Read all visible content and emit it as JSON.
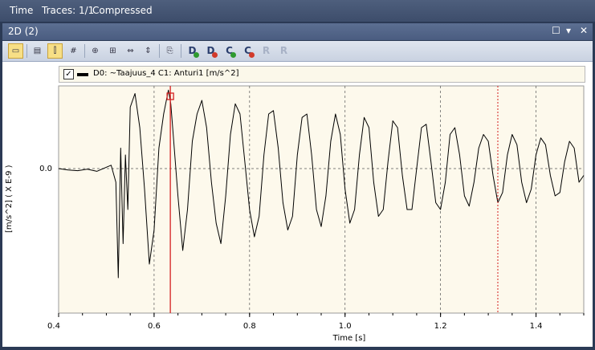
{
  "menu": {
    "time": "Time",
    "traces": "Traces: 1/1",
    "mode": "Compressed"
  },
  "panel": {
    "title": "2D (2)",
    "restore_icon": "restore-icon",
    "menu_icon": "chevron-down-icon",
    "close_icon": "close-icon"
  },
  "toolbar": {
    "buttons": [
      {
        "name": "legend-toggle-button",
        "active": true
      },
      {
        "name": "layout-button",
        "active": false
      },
      {
        "name": "single-cursor-button",
        "active": true
      },
      {
        "name": "grid-button",
        "active": false
      },
      {
        "name": "zoom-fit-button",
        "active": false
      },
      {
        "name": "zoom-in-button",
        "active": false
      },
      {
        "name": "zoom-x-button",
        "active": false
      },
      {
        "name": "zoom-y-button",
        "active": false
      },
      {
        "name": "copy-button",
        "active": false
      }
    ],
    "letters": [
      {
        "label": "D",
        "badge": "add",
        "color": "#2f9a2f",
        "enabled": true
      },
      {
        "label": "D",
        "badge": "remove",
        "color": "#d23a2a",
        "enabled": true
      },
      {
        "label": "C",
        "badge": "add",
        "color": "#2f9a2f",
        "enabled": true
      },
      {
        "label": "C",
        "badge": "remove",
        "color": "#d23a2a",
        "enabled": true
      },
      {
        "label": "R",
        "badge": "undo",
        "color": "#a8b2c6",
        "enabled": false
      },
      {
        "label": "R",
        "badge": "remove",
        "color": "#a8b2c6",
        "enabled": false
      }
    ]
  },
  "legend": {
    "checked": true,
    "label": "D0: ~Taajuus_4  C1: Anturi1 [m/s^2]"
  },
  "chart_data": {
    "type": "line",
    "xlabel": "Time [s]",
    "ylabel": "[m/s^2]   ( X E-9 )",
    "xlim": [
      0.4,
      1.5
    ],
    "x_ticks": [
      "0.4",
      "0.6",
      "0.8",
      "1.0",
      "1.2",
      "1.4"
    ],
    "y_ticks": [
      "0.0"
    ],
    "grid": true,
    "cursor_red_solid_x": 0.634,
    "cursor_red_dashed_x": 1.32,
    "colors": {
      "trace": "#000000",
      "cursor": "#d42020",
      "background": "#fdf9ec",
      "grid": "#555555"
    },
    "series": [
      {
        "x": [
          0.4,
          0.42,
          0.44,
          0.46,
          0.48,
          0.5,
          0.51,
          0.52,
          0.525,
          0.53,
          0.535,
          0.54,
          0.545,
          0.55,
          0.56,
          0.57,
          0.58,
          0.59,
          0.6,
          0.61,
          0.62,
          0.63,
          0.635,
          0.64,
          0.65,
          0.66,
          0.67,
          0.68,
          0.69,
          0.7,
          0.71,
          0.72,
          0.73,
          0.74,
          0.75,
          0.76,
          0.77,
          0.78,
          0.79,
          0.8,
          0.81,
          0.82,
          0.83,
          0.84,
          0.85,
          0.86,
          0.87,
          0.88,
          0.89,
          0.9,
          0.91,
          0.92,
          0.93,
          0.94,
          0.95,
          0.96,
          0.97,
          0.98,
          0.99,
          1.0,
          1.01,
          1.02,
          1.03,
          1.04,
          1.05,
          1.06,
          1.07,
          1.08,
          1.09,
          1.1,
          1.11,
          1.12,
          1.13,
          1.14,
          1.15,
          1.16,
          1.17,
          1.18,
          1.19,
          1.2,
          1.21,
          1.22,
          1.23,
          1.24,
          1.25,
          1.26,
          1.27,
          1.28,
          1.29,
          1.3,
          1.31,
          1.32,
          1.33,
          1.34,
          1.35,
          1.36,
          1.37,
          1.38,
          1.39,
          1.4,
          1.41,
          1.42,
          1.43,
          1.44,
          1.45,
          1.46,
          1.47,
          1.48,
          1.49,
          1.5
        ],
        "y": [
          0,
          -0.02,
          -0.03,
          -0.01,
          -0.04,
          0.02,
          0.05,
          -0.2,
          -1.6,
          0.3,
          -1.1,
          0.2,
          -0.6,
          0.9,
          1.1,
          0.6,
          -0.3,
          -1.4,
          -0.9,
          0.3,
          0.8,
          1.15,
          0.95,
          0.5,
          -0.4,
          -1.2,
          -0.6,
          0.4,
          0.8,
          1.0,
          0.6,
          -0.2,
          -0.8,
          -1.1,
          -0.4,
          0.5,
          0.95,
          0.8,
          0.1,
          -0.6,
          -1.0,
          -0.7,
          0.2,
          0.8,
          0.85,
          0.3,
          -0.5,
          -0.9,
          -0.7,
          0.2,
          0.75,
          0.8,
          0.2,
          -0.6,
          -0.85,
          -0.4,
          0.4,
          0.8,
          0.5,
          -0.3,
          -0.8,
          -0.6,
          0.2,
          0.75,
          0.6,
          -0.2,
          -0.7,
          -0.6,
          0.1,
          0.7,
          0.6,
          -0.1,
          -0.6,
          -0.6,
          0.0,
          0.6,
          0.65,
          0.1,
          -0.5,
          -0.6,
          -0.2,
          0.5,
          0.6,
          0.2,
          -0.4,
          -0.55,
          -0.2,
          0.3,
          0.5,
          0.4,
          -0.1,
          -0.5,
          -0.35,
          0.2,
          0.5,
          0.35,
          -0.2,
          -0.5,
          -0.3,
          0.2,
          0.45,
          0.35,
          -0.1,
          -0.4,
          -0.35,
          0.1,
          0.4,
          0.3,
          -0.2,
          -0.1
        ]
      }
    ]
  }
}
